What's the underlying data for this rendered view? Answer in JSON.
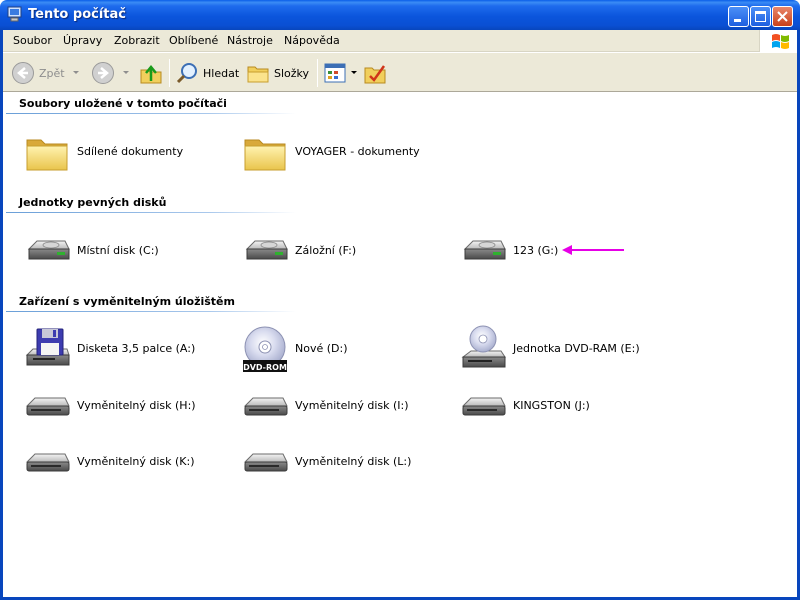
{
  "window": {
    "title": "Tento počítač"
  },
  "menu": {
    "items": [
      "Soubor",
      "Úpravy",
      "Zobrazit",
      "Oblíbené",
      "Nástroje",
      "Nápověda"
    ]
  },
  "toolbar": {
    "back_label": "Zpět",
    "search_label": "Hledat",
    "folders_label": "Složky"
  },
  "groups": [
    {
      "title": "Soubory uložené v tomto počítači",
      "items": [
        {
          "label": "Sdílené dokumenty",
          "icon": "folder-icon"
        },
        {
          "label": "VOYAGER - dokumenty",
          "icon": "folder-icon"
        }
      ]
    },
    {
      "title": "Jednotky pevných disků",
      "items": [
        {
          "label": "Místní disk (C:)",
          "icon": "hard-drive-icon"
        },
        {
          "label": "Záložní (F:)",
          "icon": "hard-drive-icon"
        },
        {
          "label": "123 (G:)",
          "icon": "hard-drive-icon"
        }
      ]
    },
    {
      "title": "Zařízení s vyměnitelným úložištěm",
      "items": [
        {
          "label": "Disketa 3,5 palce (A:)",
          "icon": "floppy-drive-icon"
        },
        {
          "label": "Nové (D:)",
          "icon": "dvd-rom-icon",
          "badge": "DVD-ROM"
        },
        {
          "label": "Jednotka DVD-RAM (E:)",
          "icon": "dvd-ram-drive-icon"
        },
        {
          "label": "Vyměnitelný disk (H:)",
          "icon": "removable-disk-icon"
        },
        {
          "label": "Vyměnitelný disk (I:)",
          "icon": "removable-disk-icon"
        },
        {
          "label": "KINGSTON (J:)",
          "icon": "removable-disk-icon"
        },
        {
          "label": "Vyměnitelný disk (K:)",
          "icon": "removable-disk-icon"
        },
        {
          "label": "Vyměnitelný disk (L:)",
          "icon": "removable-disk-icon"
        }
      ]
    }
  ],
  "colors": {
    "titlebar": "#0a55dc",
    "chrome": "#ece9d8",
    "annotation_arrow": "#e600e6"
  }
}
